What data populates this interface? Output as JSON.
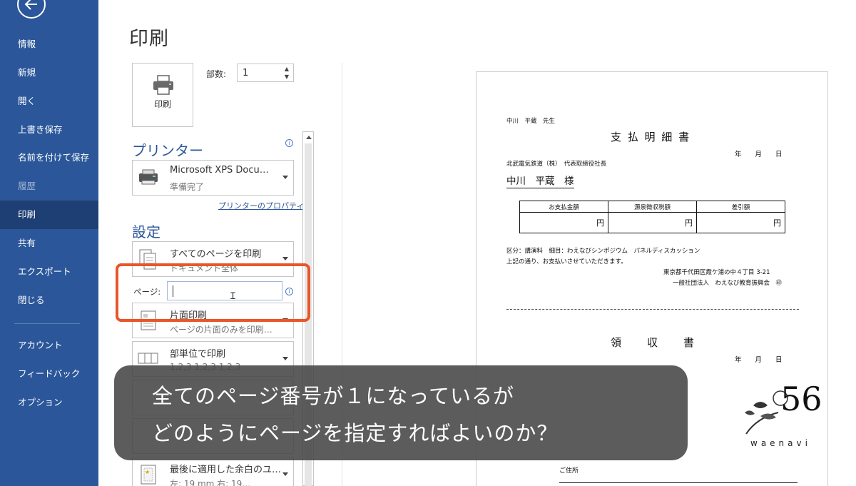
{
  "sidebar": {
    "back_label": "",
    "items": [
      {
        "label": "情報"
      },
      {
        "label": "新規"
      },
      {
        "label": "開く"
      },
      {
        "label": "上書き保存"
      },
      {
        "label": "名前を付けて保存"
      },
      {
        "label": "履歴"
      },
      {
        "label": "印刷"
      },
      {
        "label": "共有"
      },
      {
        "label": "エクスポート"
      },
      {
        "label": "閉じる"
      },
      {
        "label": "アカウント"
      },
      {
        "label": "フィードバック"
      },
      {
        "label": "オプション"
      }
    ],
    "active": "印刷",
    "disabled": "履歴"
  },
  "main": {
    "title": "印刷",
    "print_button_label": "印刷",
    "copies_label": "部数:",
    "copies_value": "1",
    "printer_heading": "プリンター",
    "printer": {
      "name": "Microsoft XPS Docu…",
      "status": "準備完了"
    },
    "printer_properties": "プリンターのプロパティ",
    "settings_heading": "設定",
    "settings": [
      {
        "line1": "すべてのページを印刷",
        "line2": "ドキュメント全体"
      },
      {
        "line1": "片面印刷",
        "line2": "ページの片面のみを印刷…"
      },
      {
        "line1": "部単位で印刷",
        "line2": "1,2,3    1,2,3    1,2,3"
      },
      {
        "line1": "最後に適用した余白のユ…",
        "line2": "左: 19 mm   右: 19…"
      }
    ],
    "pages_label": "ページ:",
    "pages_value": ""
  },
  "preview": {
    "recipient_top": "中川　平蔵　先生",
    "title1": "支 払 明 細 書",
    "date1": "年　　月　　日",
    "company": "北武電気鉄道（株）　代表取締役社長",
    "recipient_sama": "中川　平蔵　様",
    "table_headers": [
      "お支払金額",
      "源泉徴収税額",
      "差引額"
    ],
    "table_values": [
      "円",
      "円",
      "円"
    ],
    "category_line": "区分：講演料　細目：わえなびシンポジウム　パネルディスカッション",
    "notice_line": "上記の通り、お支払いさせていただきます。",
    "address": "東京都千代田区霞ケ浦の中４丁目 3-21",
    "org": "一般社団法人　わえなび教育振興会　㊞",
    "title2": "領　　収　　書",
    "date2": "年　　月　　日",
    "address_label": "ご住所"
  },
  "overlay": {
    "line1": "全てのページ番号が１になっているが",
    "line2": "どのようにページを指定すればよいのか？"
  },
  "logo": {
    "number": "56",
    "word": "waenavi"
  },
  "colors": {
    "sidebar": "#2b579a",
    "sidebar_active": "#1e3f73",
    "accent": "#2b579a",
    "highlight": "#e8562a"
  }
}
